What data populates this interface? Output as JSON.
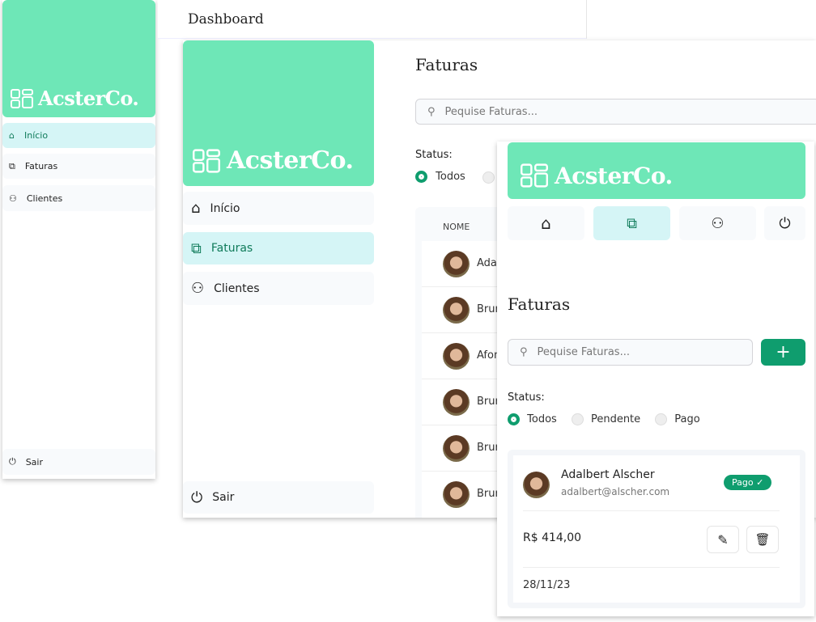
{
  "brand": "AcsterCo.",
  "header_title": "Dashboard",
  "nav": {
    "inicio": "Início",
    "faturas": "Faturas",
    "clientes": "Clientes",
    "sair": "Sair"
  },
  "page_title": "Faturas",
  "search_placeholder": "Pequise Faturas...",
  "status": {
    "label": "Status:",
    "options": [
      "Todos",
      "Pendente",
      "Pago"
    ],
    "selected": "Todos"
  },
  "table": {
    "header": "NOME",
    "rows": [
      "Adalbert",
      "Bruna",
      "Afonso",
      "Bruna",
      "Bruna",
      "Bruna"
    ]
  },
  "card": {
    "name": "Adalbert Alscher",
    "email": "adalbert@alscher.com",
    "badge": "Pago",
    "amount": "R$ 414,00",
    "date": "28/11/23"
  },
  "colors": {
    "brand": "#6ee7b7",
    "accent": "#0f9d6e",
    "active_nav": "#d5f5f6"
  }
}
